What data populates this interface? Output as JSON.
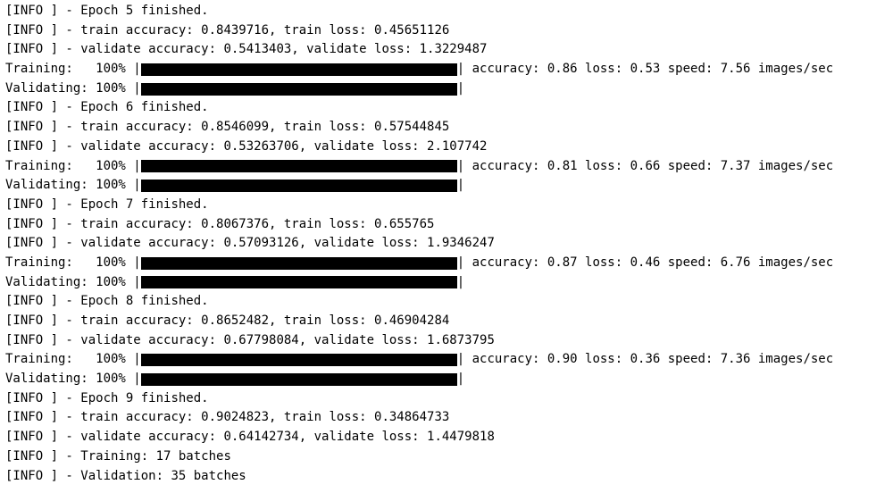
{
  "log_prefix": "[INFO ] - ",
  "epochs": [
    {
      "n": 5,
      "finished": "Epoch 5 finished.",
      "train_line": "train accuracy: 0.8439716, train loss: 0.45651126",
      "val_line": "validate accuracy: 0.5413403, validate loss: 1.3229487",
      "training_label": "Training:   100% |",
      "training_end": "|",
      "training_metrics": " accuracy: 0.86 loss: 0.53 speed: 7.56 images/sec",
      "validating_label": "Validating: 100% |",
      "validating_end": "|"
    },
    {
      "n": 6,
      "finished": "Epoch 6 finished.",
      "train_line": "train accuracy: 0.8546099, train loss: 0.57544845",
      "val_line": "validate accuracy: 0.53263706, validate loss: 2.107742",
      "training_label": "Training:   100% |",
      "training_end": "|",
      "training_metrics": " accuracy: 0.81 loss: 0.66 speed: 7.37 images/sec",
      "validating_label": "Validating: 100% |",
      "validating_end": "|"
    },
    {
      "n": 7,
      "finished": "Epoch 7 finished.",
      "train_line": "train accuracy: 0.8067376, train loss: 0.655765",
      "val_line": "validate accuracy: 0.57093126, validate loss: 1.9346247",
      "training_label": "Training:   100% |",
      "training_end": "|",
      "training_metrics": " accuracy: 0.87 loss: 0.46 speed: 6.76 images/sec",
      "validating_label": "Validating: 100% |",
      "validating_end": "|"
    },
    {
      "n": 8,
      "finished": "Epoch 8 finished.",
      "train_line": "train accuracy: 0.8652482, train loss: 0.46904284",
      "val_line": "validate accuracy: 0.67798084, validate loss: 1.6873795",
      "training_label": "Training:   100% |",
      "training_end": "|",
      "training_metrics": " accuracy: 0.90 loss: 0.36 speed: 7.36 images/sec",
      "validating_label": "Validating: 100% |",
      "validating_end": "|"
    },
    {
      "n": 9,
      "finished": "Epoch 9 finished.",
      "train_line": "train accuracy: 0.9024823, train loss: 0.34864733",
      "val_line": "validate accuracy: 0.64142734, validate loss: 1.4479818",
      "training_batches": "Training: 17 batches",
      "validation_batches": "Validation: 35 batches"
    }
  ]
}
